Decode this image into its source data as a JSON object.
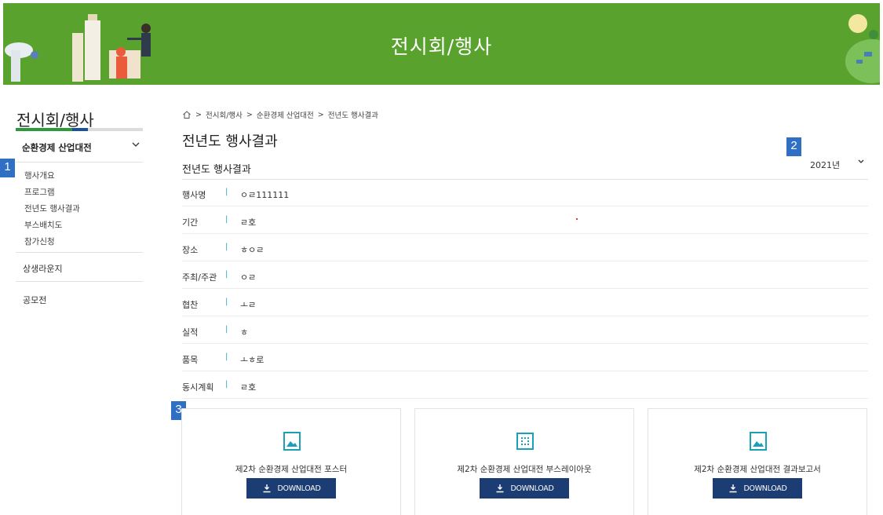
{
  "banner": {
    "title": "전시회/행사"
  },
  "sidebar": {
    "title": "전시회/행사",
    "section": "순환경제 산업대전",
    "sub_items": [
      "행사개요",
      "프로그램",
      "전년도 행사결과",
      "부스배치도",
      "참가신청"
    ],
    "items": [
      "상생라운지",
      "공모전"
    ]
  },
  "markers": [
    "1",
    "2",
    "3"
  ],
  "breadcrumb": [
    "전시회/행사",
    "순환경제 산업대전",
    "전년도 행사결과"
  ],
  "breadcrumb_sep": ">",
  "page_title": "전년도 행사결과",
  "section_title": "전년도 행사결과",
  "year_select": {
    "value": "2021년"
  },
  "details": [
    {
      "label": "행사명",
      "value": "ㅇㄹ111111"
    },
    {
      "label": "기간",
      "value": "ㄹ호"
    },
    {
      "label": "장소",
      "value": "ㅎㅇㄹ"
    },
    {
      "label": "주최/주관",
      "value": "ㅇㄹ"
    },
    {
      "label": "협찬",
      "value": "ㅗㄹ"
    },
    {
      "label": "실적",
      "value": "ㅎ"
    },
    {
      "label": "품목",
      "value": "ㅗㅎ로"
    },
    {
      "label": "동시계획",
      "value": "ㄹ호"
    }
  ],
  "detail_separator": "|",
  "cards": [
    {
      "caption": "제2차 순환경제 산업대전 포스터",
      "button": "DOWNLOAD",
      "icon": "image-icon"
    },
    {
      "caption": "제2차 순환경제 산업대전 부스레이아웃",
      "button": "DOWNLOAD",
      "icon": "grid-layout-icon"
    },
    {
      "caption": "제2차 순환경제 산업대전 결과보고서",
      "button": "DOWNLOAD",
      "icon": "image-icon"
    }
  ],
  "colors": {
    "banner": "#5aa22e",
    "button": "#1c3d73",
    "accent": "#29a6b5",
    "marker": "#2f6fc4"
  }
}
